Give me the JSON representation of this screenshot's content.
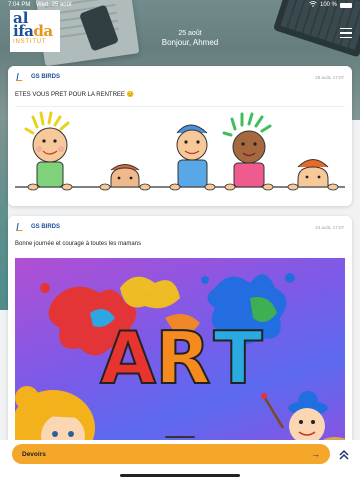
{
  "status_bar": {
    "time": "7:04 PM",
    "date": "Wed, 25 août",
    "battery": "100 %"
  },
  "logo": {
    "line1": "al",
    "line2_main": "ifa",
    "line2_accent": "da",
    "line3": "INSTITUT"
  },
  "header": {
    "date": "25 août",
    "greeting": "Bonjour, Ahmed"
  },
  "posts": [
    {
      "author": "GS BIRDS",
      "time": "25 août, 17:07",
      "text": "ETES VOUS PRET POUR LA RENTREE 😊"
    },
    {
      "author": "GS BIRDS",
      "time": "24 août, 17:07",
      "text": "Bonne journée et courage à toutes les mamans",
      "image_text": "ART"
    }
  ],
  "bottom": {
    "devoirs_label": "Devoirs",
    "arrow": "→"
  },
  "colors": {
    "brand_blue": "#1d4e9a",
    "brand_orange": "#e8941a",
    "devoirs_bg": "#f4a72b"
  }
}
